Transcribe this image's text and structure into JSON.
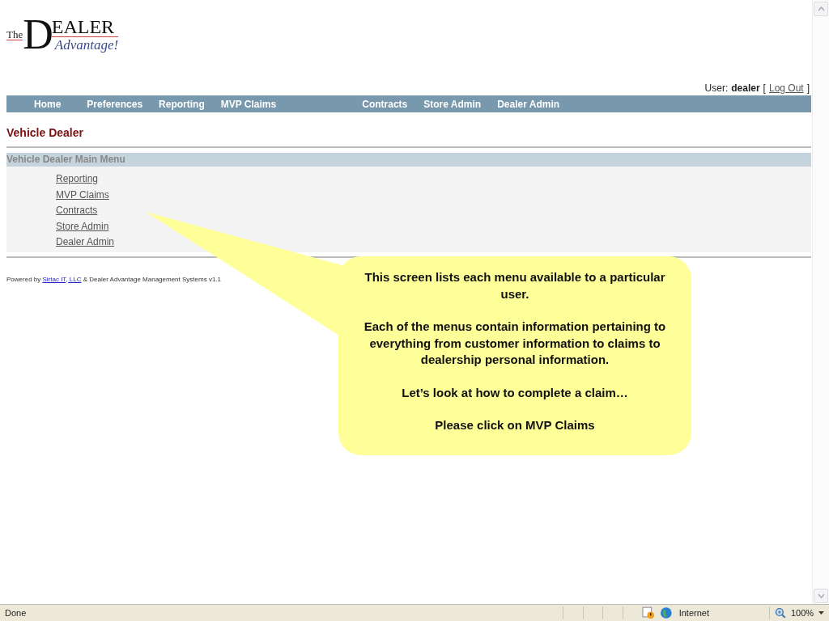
{
  "logo": {
    "the": "The",
    "big_letter": "D",
    "rest": "EALER",
    "tagline": "Advantage!"
  },
  "user_bar": {
    "label": "User:",
    "name": "dealer",
    "open_bracket": "[",
    "logout": "Log Out",
    "close_bracket": "]"
  },
  "nav": [
    "Home",
    "Preferences",
    "Reporting",
    "MVP Claims",
    "Contracts",
    "Store Admin",
    "Dealer Admin"
  ],
  "page_title": "Vehicle Dealer",
  "menu": {
    "heading": "Vehicle Dealer Main Menu",
    "items": [
      "Reporting",
      "MVP Claims",
      "Contracts",
      "Store Admin",
      "Dealer Admin"
    ]
  },
  "footer": {
    "prefix": "Powered by",
    "link": "Sirtac IT, LLC",
    "suffix": "& Dealer Advantage Management Systems v1.1"
  },
  "callout": {
    "paragraphs": [
      "This screen lists each menu available to a particular user.",
      "Each of the menus contain information pertaining to everything from customer information to claims to dealership personal information.",
      "Let’s look at how to complete a claim…",
      "Please click on MVP Claims"
    ]
  },
  "status_bar": {
    "status": "Done",
    "zone": "Internet",
    "zoom": "100%"
  }
}
